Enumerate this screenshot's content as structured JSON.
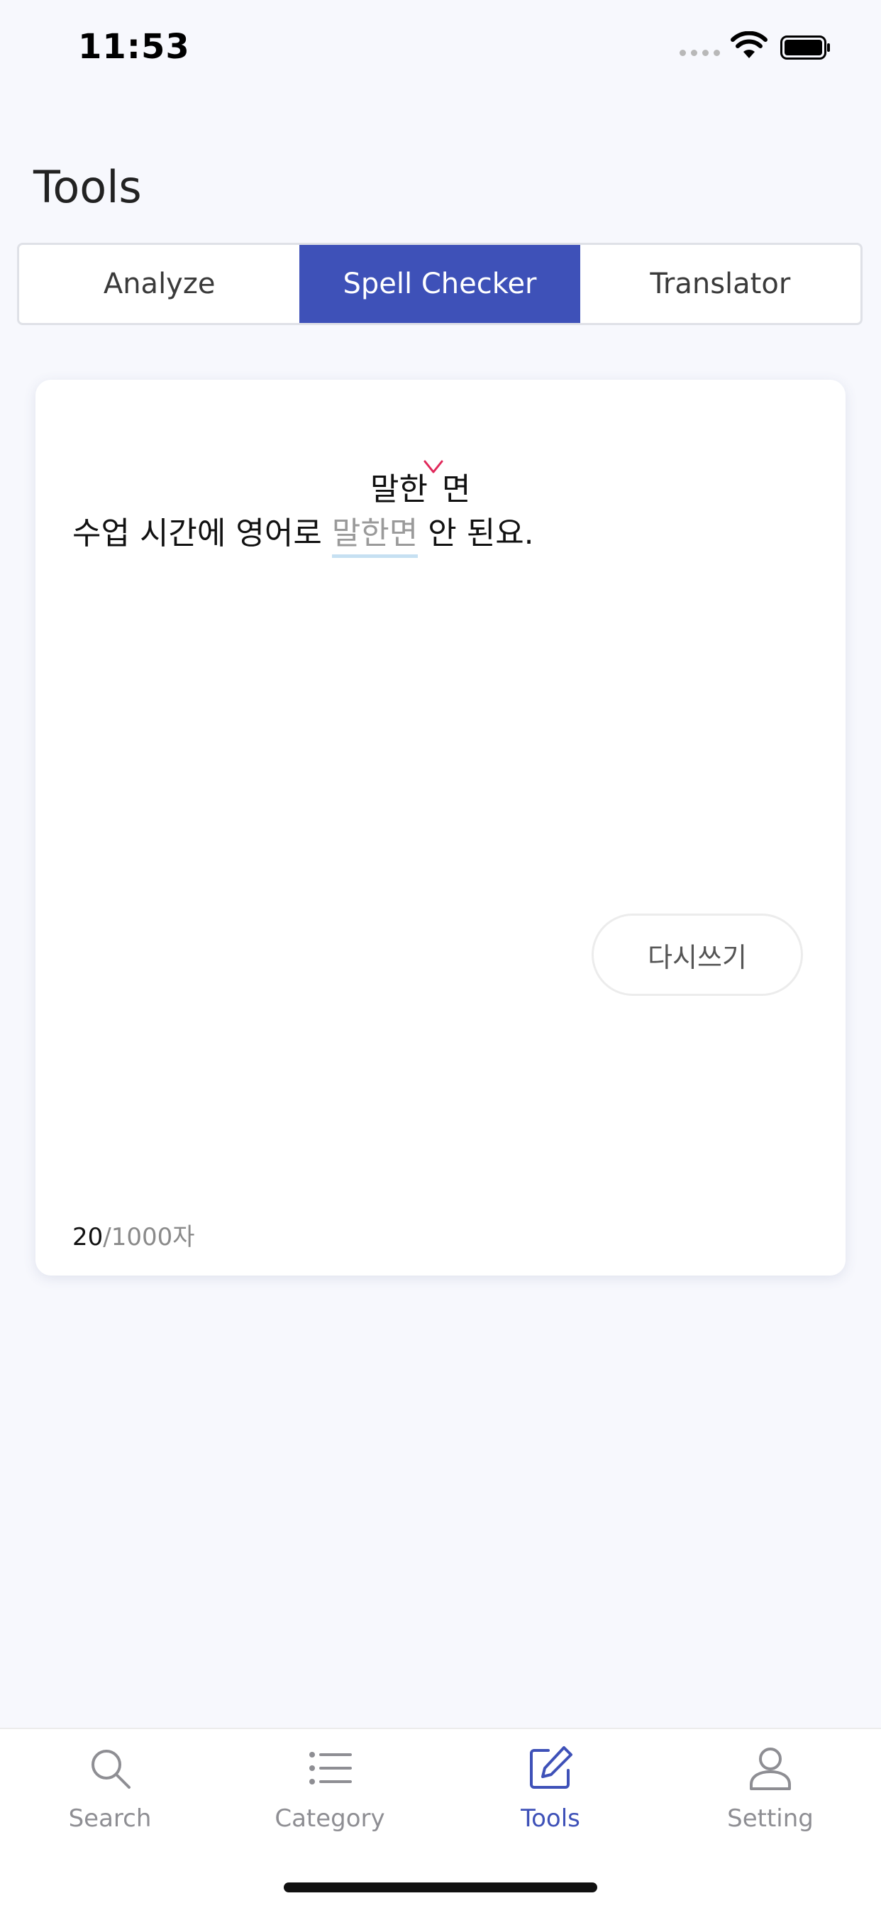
{
  "status_bar": {
    "time": "11:53"
  },
  "page": {
    "title": "Tools"
  },
  "tabs": [
    {
      "label": "Analyze",
      "active": false
    },
    {
      "label": "Spell Checker",
      "active": true
    },
    {
      "label": "Translator",
      "active": false
    }
  ],
  "editor": {
    "sentence_before": "수업 시간에 영어로 ",
    "error_word": "말한면",
    "sentence_after": " 안 된요.",
    "suggestion_part1": "말한",
    "suggestion_part2": "면",
    "rewrite_button": "다시쓰기",
    "char_count": "20",
    "char_limit": "/1000자"
  },
  "tab_bar": {
    "items": [
      {
        "label": "Search",
        "icon": "search-icon",
        "active": false
      },
      {
        "label": "Category",
        "icon": "list-icon",
        "active": false
      },
      {
        "label": "Tools",
        "icon": "edit-icon",
        "active": true
      },
      {
        "label": "Setting",
        "icon": "person-icon",
        "active": false
      }
    ]
  },
  "colors": {
    "accent": "#3e51b8",
    "error_marker": "#e0285a",
    "error_underline": "#c6e0f2",
    "background": "#f7f8fd"
  }
}
